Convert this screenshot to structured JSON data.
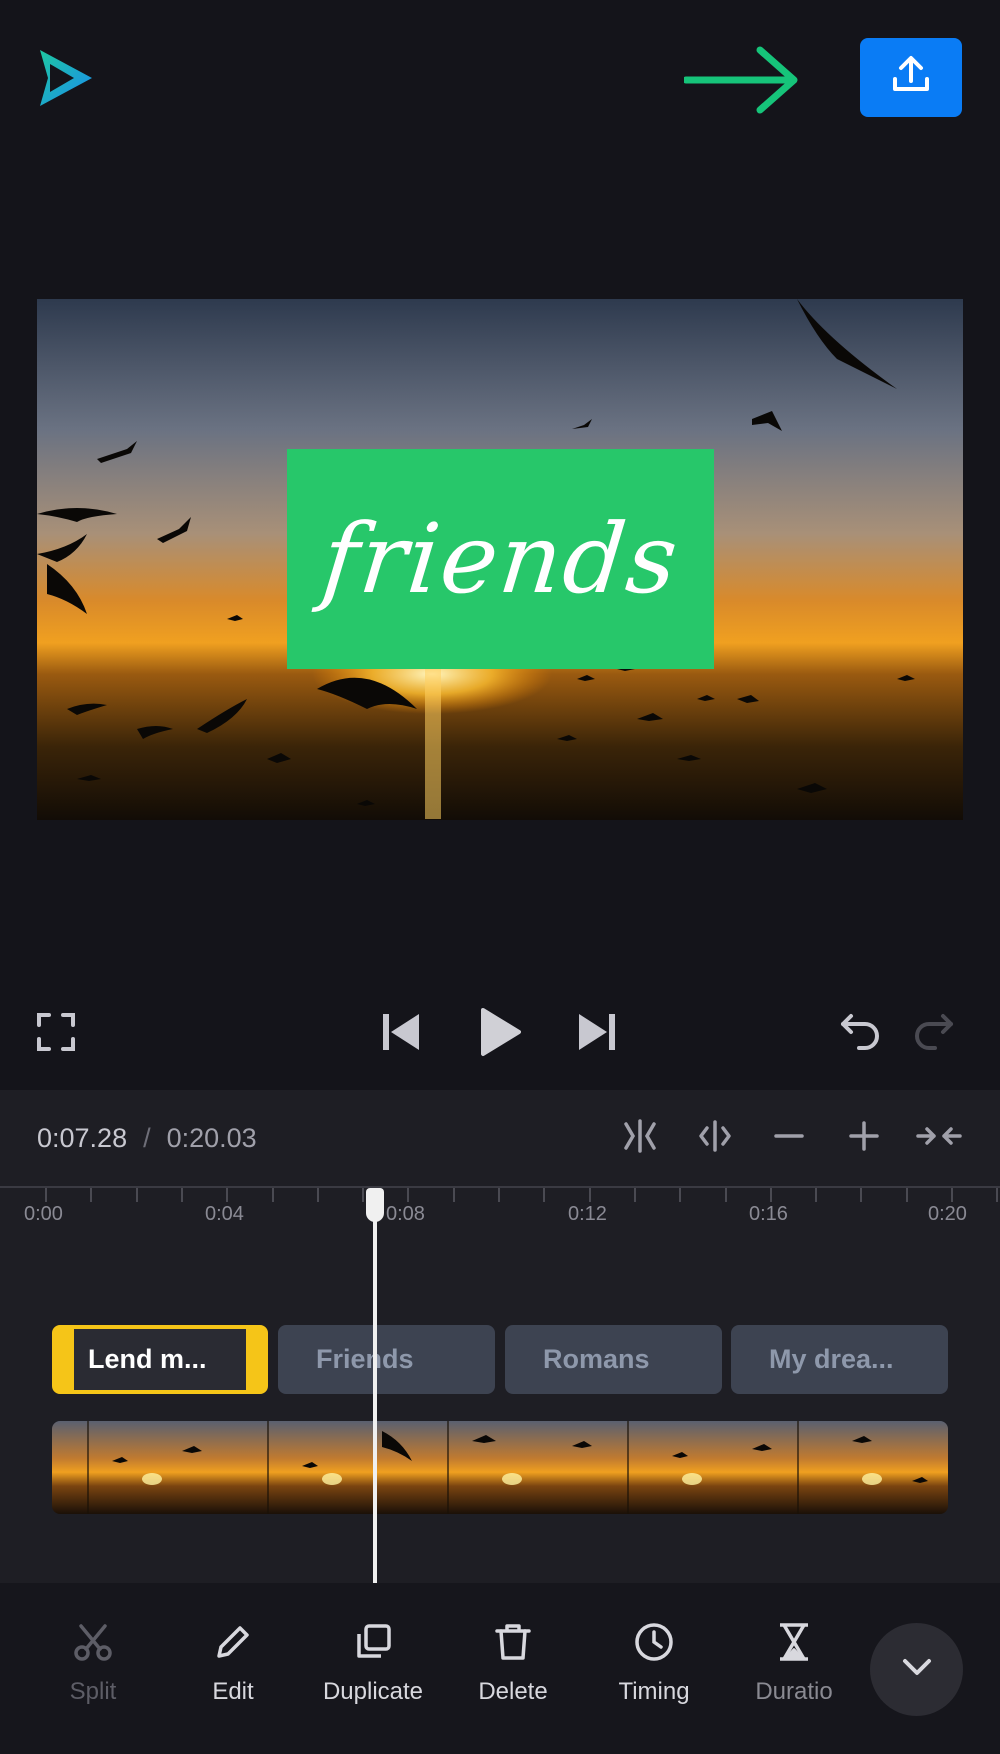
{
  "app": {
    "logo": "app-logo-play-icon",
    "export_icon": "upload-icon",
    "hint_icon": "arrow-right-icon",
    "colors": {
      "accent": "#0a7cf5",
      "hint": "#16c47a",
      "title_card": "#27c76a",
      "selection": "#f5c518"
    }
  },
  "preview": {
    "title_text": "friends"
  },
  "playback": {
    "icons": [
      "fullscreen-icon",
      "skip-back-icon",
      "play-icon",
      "skip-forward-icon",
      "undo-icon",
      "redo-icon"
    ]
  },
  "timeline": {
    "current_time": "0:07.28",
    "separator": "/",
    "total_time": "0:20.03",
    "tools": [
      "split-clip-icon",
      "trim-icon",
      "zoom-out-icon",
      "zoom-in-icon",
      "fit-icon"
    ],
    "ruler_labels": [
      "0:00",
      "0:04",
      "0:08",
      "0:12",
      "0:16",
      "0:20"
    ],
    "text_clips": [
      {
        "label": "Lend m...",
        "selected": true
      },
      {
        "label": "Friends",
        "selected": false
      },
      {
        "label": "Romans",
        "selected": false
      },
      {
        "label": "My drea...",
        "selected": false
      }
    ]
  },
  "toolbar": {
    "items": [
      {
        "label": "Split",
        "icon": "scissors-icon",
        "enabled": false
      },
      {
        "label": "Edit",
        "icon": "pencil-icon",
        "enabled": true
      },
      {
        "label": "Duplicate",
        "icon": "duplicate-icon",
        "enabled": true
      },
      {
        "label": "Delete",
        "icon": "trash-icon",
        "enabled": true
      },
      {
        "label": "Timing",
        "icon": "clock-icon",
        "enabled": true
      },
      {
        "label": "Duratio",
        "icon": "hourglass-icon",
        "enabled": true
      }
    ],
    "collapse_icon": "chevron-down-icon"
  }
}
